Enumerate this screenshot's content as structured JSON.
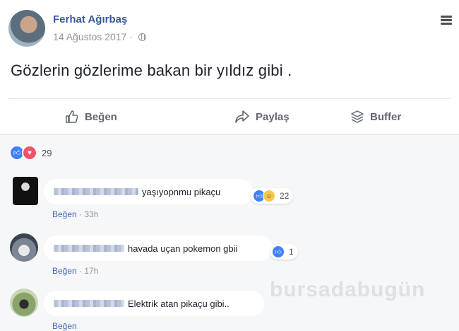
{
  "post": {
    "author": "Ferhat Ağırbaş",
    "date": "14 Ağustos 2017 · ",
    "text": "Gözlerin gözlerime bakan bir yıldız gibi ."
  },
  "actions": {
    "like_label": "Beğen",
    "share_label": "Paylaş",
    "buffer_label": "Buffer"
  },
  "reactions": {
    "count": "29"
  },
  "comments": [
    {
      "text": "yaşıyopnmu pikaçu",
      "like_label": "Beğen",
      "time": " · 33h",
      "reaction_count": "22"
    },
    {
      "text": "havada uçan pokemon gbii",
      "like_label": "Beğen",
      "time": " · 17h",
      "reaction_count": "1"
    },
    {
      "text": "Elektrik atan pikaçu gibi..",
      "like_label": "Beğen",
      "time": ""
    }
  ],
  "watermark": "bursadabugün",
  "colors": {
    "link": "#365899",
    "like_blue": "#4080ff",
    "love_red": "#f25268"
  }
}
